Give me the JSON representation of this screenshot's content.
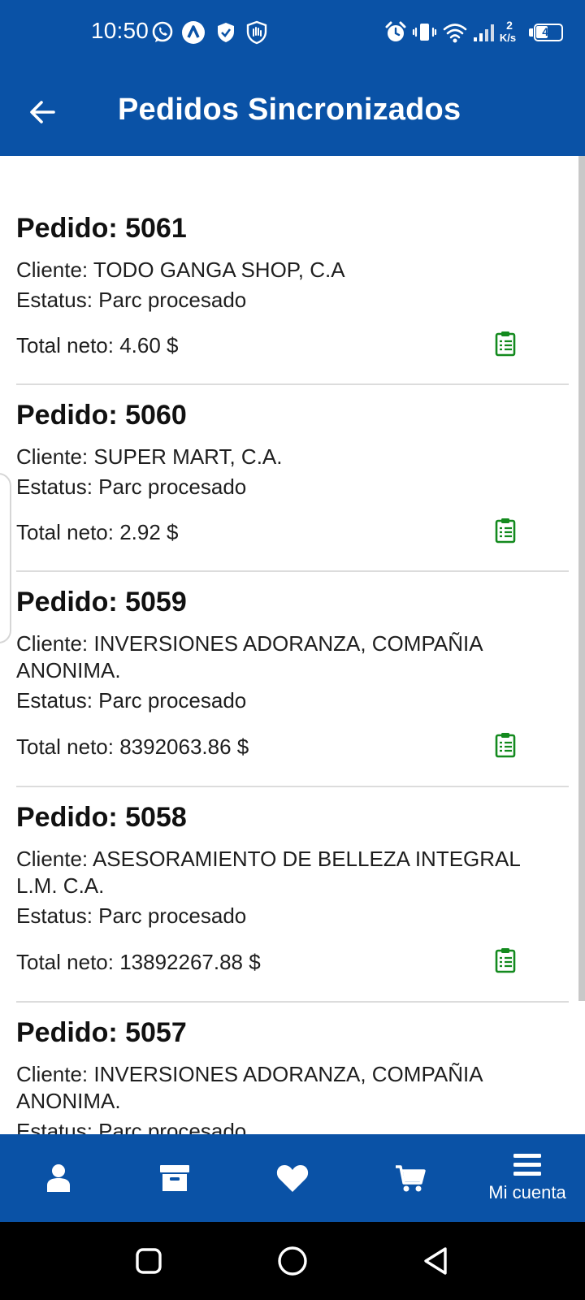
{
  "status_bar": {
    "time": "10:50",
    "network_speed_value": "2",
    "network_speed_unit": "K/s",
    "battery_level": "49",
    "battery_fraction": 0.49
  },
  "app_bar": {
    "title": "Pedidos Sincronizados"
  },
  "orders": [
    {
      "title": "Pedido: 5061",
      "client": "Cliente: TODO GANGA SHOP, C.A",
      "status": "Estatus: Parc procesado",
      "total": "Total neto: 4.60 $"
    },
    {
      "title": "Pedido: 5060",
      "client": "Cliente: SUPER MART, C.A.",
      "status": "Estatus: Parc procesado",
      "total": "Total neto: 2.92 $"
    },
    {
      "title": "Pedido: 5059",
      "client": "Cliente: INVERSIONES ADORANZA, COMPAÑIA ANONIMA.",
      "status": "Estatus: Parc procesado",
      "total": "Total neto: 8392063.86 $"
    },
    {
      "title": "Pedido: 5058",
      "client": "Cliente: ASESORAMIENTO DE BELLEZA INTEGRAL L.M. C.A.",
      "status": "Estatus: Parc procesado",
      "total": "Total neto: 13892267.88 $"
    },
    {
      "title": "Pedido: 5057",
      "client": "Cliente: INVERSIONES ADORANZA, COMPAÑIA ANONIMA.",
      "status": "Estatus: Parc procesado",
      "total": ""
    }
  ],
  "bottom_nav": {
    "items": [
      {
        "icon": "user-icon"
      },
      {
        "icon": "archive-box-icon"
      },
      {
        "icon": "heart-icon"
      },
      {
        "icon": "cart-icon"
      },
      {
        "icon": "menu-icon",
        "label": "Mi cuenta"
      }
    ]
  },
  "colors": {
    "primary": "#0a52a6",
    "accent_icon": "#138a1e",
    "divider": "#dcdcdc"
  }
}
